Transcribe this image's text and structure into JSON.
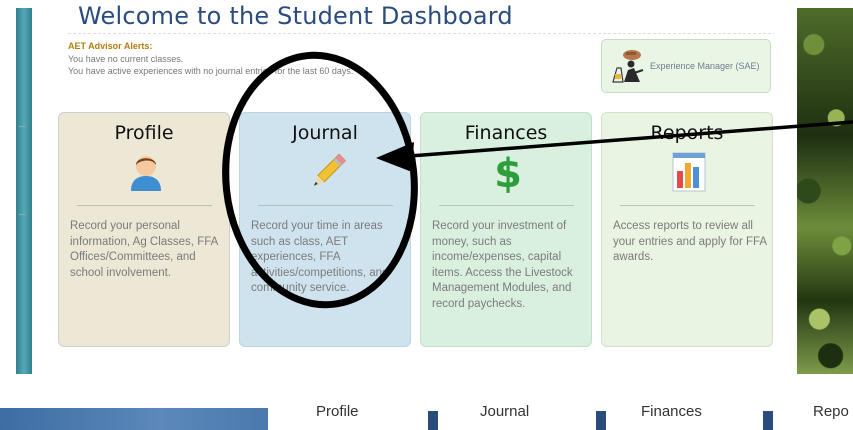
{
  "header": {
    "title": "Welcome to the Student Dashboard"
  },
  "alerts": {
    "title": "AET Advisor Alerts:",
    "lines": [
      "You have no current classes.",
      "You have active experiences with no journal entries for the last 60 days."
    ]
  },
  "sae": {
    "label": "Experience Manager (SAE)",
    "icon": "farmer-tractor-icon"
  },
  "cards": [
    {
      "title": "Profile",
      "icon": "user-avatar-icon",
      "description": "Record your personal information, Ag Classes, FFA Offices/Committees, and school involvement."
    },
    {
      "title": "Journal",
      "icon": "pencil-icon",
      "description": "Record your time in areas such as class, AET experiences, FFA activities/competitions, and community service."
    },
    {
      "title": "Finances",
      "icon": "dollar-sign-icon",
      "description": "Record your investment of money, such as income/expenses, capital items. Access the Livestock Management Modules, and record paychecks."
    },
    {
      "title": "Reports",
      "icon": "bar-chart-icon",
      "description": "Access reports to review all your entries and apply for FFA awards."
    }
  ],
  "bottom_strip": {
    "tabs": [
      "Profile",
      "Journal",
      "Finances",
      "Repo"
    ]
  },
  "colors": {
    "title": "#2b4c7e",
    "alert_title": "#b07d10",
    "profile_card": "#ede7d5",
    "journal_card": "#cfe3ee",
    "finances_card": "#d9f0df",
    "reports_card": "#eaf4e2",
    "dollar": "#2e9e3c"
  }
}
